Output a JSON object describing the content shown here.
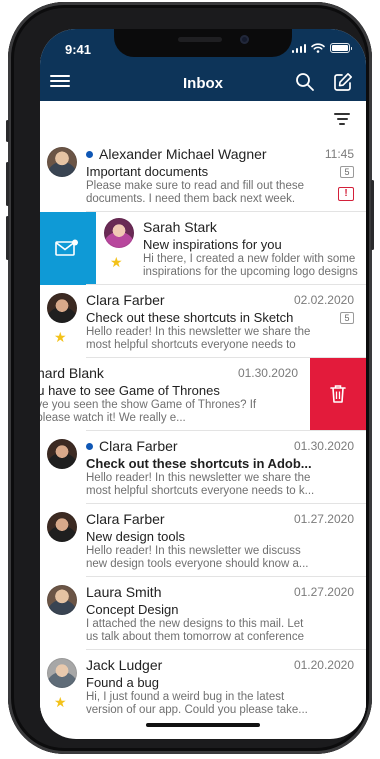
{
  "status_bar": {
    "time": "9:41"
  },
  "header": {
    "title": "Inbox"
  },
  "colors": {
    "header_bg": "#0d3459",
    "unread_dot": "#0f57b5",
    "star": "#f3c21a",
    "swipe_read": "#0f9ad6",
    "swipe_delete": "#e31b3b",
    "alert": "#d3203a"
  },
  "icons": {
    "menu": "hamburger-menu-icon",
    "search": "search-icon",
    "compose": "compose-icon",
    "filter": "filter-icon",
    "mark_read": "mail-icon",
    "delete": "trash-icon"
  },
  "messages": [
    {
      "sender": "Alexander Michael Wagner",
      "unread": true,
      "date": "11:45",
      "subject": "Important documents",
      "preview": "Please make sure to read and fill out these documents. I need them back next week.",
      "count": "5",
      "alert": "!",
      "starred": false
    },
    {
      "sender": "Sarah Stark",
      "unread": false,
      "date": "",
      "subject": "New inspirations for you",
      "preview": "Hi there, I created a new folder with some inspirations for the upcoming logo designs",
      "starred": true,
      "swipe": "mark-read"
    },
    {
      "sender": "Clara Farber",
      "unread": false,
      "date": "02.02.2020",
      "subject": "Check out these shortcuts in Sketch",
      "preview": "Hello reader! In this newsletter we share the most helpful shortcuts everyone needs to kn...",
      "count": "5",
      "starred": true
    },
    {
      "sender": "chard Blank",
      "unread": false,
      "date": "01.30.2020",
      "subject": "ou have to see Game of Thrones",
      "preview": "ave you seen the show Game of Thrones? If t please watch it! We really e...",
      "starred": false,
      "swipe": "delete"
    },
    {
      "sender": "Clara Farber",
      "unread": true,
      "date": "01.30.2020",
      "subject": "Check out these shortcuts in Adob...",
      "preview": "Hello reader! In this newsletter we share the most helpful shortcuts everyone needs to k...",
      "starred": false
    },
    {
      "sender": "Clara Farber",
      "unread": false,
      "date": "01.27.2020",
      "subject": "New design tools",
      "preview": "Hello reader! In this newsletter we discuss new design tools everyone should know a...",
      "starred": false
    },
    {
      "sender": "Laura Smith",
      "unread": false,
      "date": "01.27.2020",
      "subject": "Concept Design",
      "preview": "I attached the new designs to this mail. Let us talk about them tomorrow at conference in...",
      "starred": false
    },
    {
      "sender": "Jack Ludger",
      "unread": false,
      "date": "01.20.2020",
      "subject": "Found a bug",
      "preview": "Hi, I just found a weird bug in the latest version of our app. Could you please take...",
      "starred": true
    }
  ]
}
